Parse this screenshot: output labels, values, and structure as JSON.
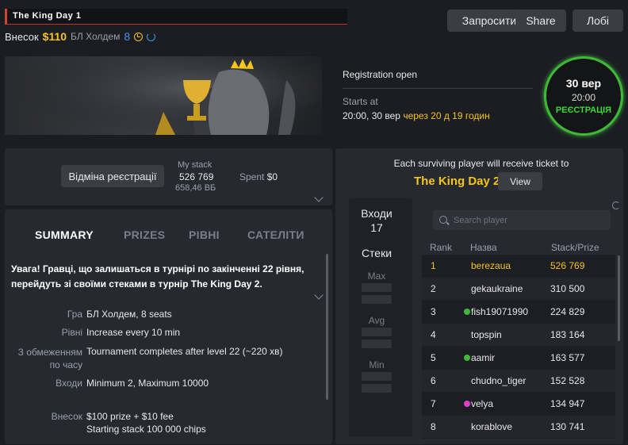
{
  "tournament": {
    "title": "The King Day 1",
    "buyin_label": "Внесок",
    "buyin_value": "$110",
    "game_short": "БЛ Холдем",
    "seats": "8"
  },
  "header_buttons": {
    "invite": "Запросити",
    "share": "Share",
    "lobby": "Лобі"
  },
  "registration": {
    "status": "Registration open",
    "starts_label": "Starts at",
    "starts_value": "20:00, 30 вер",
    "starts_relative": "через 20 д 19 годин"
  },
  "date_badge": {
    "date": "30 вер",
    "time": "20:00",
    "label": "РЕЄСТРАЦІЯ",
    "color": "#3fb83a"
  },
  "my_panel": {
    "unregister_button": "Відміна реєстрації",
    "my_stack_label": "My stack",
    "my_stack_value": "526 769",
    "my_stack_bb": "658,46 ВБ",
    "spent_label": "Spent",
    "spent_value": "$0"
  },
  "tabs": [
    "SUMMARY",
    "PRIZES",
    "РІВНІ",
    "САТЕЛІТИ"
  ],
  "summary": {
    "warning": "Увага! Гравці, що залишаться в турнірі по закінченні 22 рівня, перейдуть зі своїми стеками в турнір The King Day 2.",
    "rows": [
      {
        "label": "Гра",
        "value": "БЛ Холдем, 8 seats"
      },
      {
        "label": "Рівні",
        "value": "Increase every 10 min"
      },
      {
        "label": "З обмеженням по часу",
        "value": "Tournament completes after level 22 (~220 хв)"
      },
      {
        "label": "Входи",
        "value": "Minimum 2, Maximum 10000"
      },
      {
        "label": "Внесок",
        "value": "$100 prize + $10 fee",
        "value2": "Starting stack 100 000 chips"
      }
    ]
  },
  "next_event": {
    "info": "Each surviving player will receive ticket to",
    "name": "The King Day 2",
    "view_button": "View"
  },
  "stats": {
    "entries_label": "Входи",
    "entries_value": "17",
    "stacks_label": "Стеки",
    "max_label": "Max",
    "avg_label": "Avg",
    "min_label": "Min"
  },
  "players": {
    "search_placeholder": "Search player",
    "columns": [
      "Rank",
      "Назва",
      "Stack/Prize"
    ],
    "rows": [
      {
        "rank": "1",
        "name": "berezaua",
        "stack": "526 769",
        "me": true
      },
      {
        "rank": "2",
        "name": "gekaukraine",
        "stack": "310 500"
      },
      {
        "rank": "3",
        "name": "fish19071990",
        "stack": "224 829",
        "dot": "#3fb83a"
      },
      {
        "rank": "4",
        "name": "topspin",
        "stack": "183 164"
      },
      {
        "rank": "5",
        "name": "aamir",
        "stack": "163 577",
        "dot": "#3fb83a"
      },
      {
        "rank": "6",
        "name": "chudno_tiger",
        "stack": "152 528"
      },
      {
        "rank": "7",
        "name": "velya",
        "stack": "134 947",
        "dot": "#e040c8"
      },
      {
        "rank": "8",
        "name": "korablove",
        "stack": "130 741"
      }
    ]
  },
  "colors": {
    "accent": "#f5c518",
    "seats": "#4f8df5",
    "highlight": "#d0452f"
  }
}
